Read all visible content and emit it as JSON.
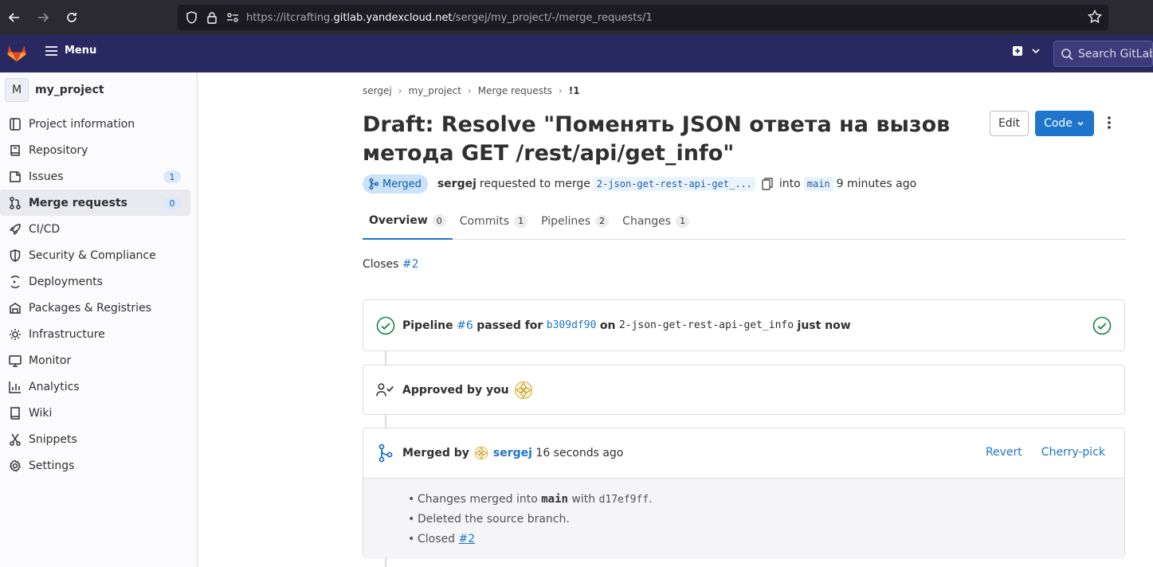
{
  "browser": {
    "url_prefix": "https://itcrafting.",
    "url_host": "gitlab.yandexcloud.net",
    "url_path": "/sergej/my_project/-/merge_requests/1"
  },
  "topbar": {
    "menu_label": "Menu",
    "search_placeholder": "Search GitLab"
  },
  "sidebar": {
    "project_initial": "M",
    "project_name": "my_project",
    "items": [
      {
        "label": "Project information"
      },
      {
        "label": "Repository"
      },
      {
        "label": "Issues",
        "count": "1"
      },
      {
        "label": "Merge requests",
        "count": "0"
      },
      {
        "label": "CI/CD"
      },
      {
        "label": "Security & Compliance"
      },
      {
        "label": "Deployments"
      },
      {
        "label": "Packages & Registries"
      },
      {
        "label": "Infrastructure"
      },
      {
        "label": "Monitor"
      },
      {
        "label": "Analytics"
      },
      {
        "label": "Wiki"
      },
      {
        "label": "Snippets"
      },
      {
        "label": "Settings"
      }
    ]
  },
  "breadcrumb": [
    "sergej",
    "my_project",
    "Merge requests",
    "!1"
  ],
  "mr": {
    "title_line1": "Draft: Resolve \"Поменять JSON ответа на вызов",
    "title_line2": "метода GET /rest/api/get_info\"",
    "edit_label": "Edit",
    "code_label": "Code",
    "status": "Merged",
    "author": "sergej",
    "requested_text": "requested to merge",
    "source_branch": "2-json-get-rest-api-get_...",
    "into_text": "into",
    "target_branch": "main",
    "time": "9 minutes ago"
  },
  "tabs": [
    {
      "label": "Overview",
      "count": "0"
    },
    {
      "label": "Commits",
      "count": "1"
    },
    {
      "label": "Pipelines",
      "count": "2"
    },
    {
      "label": "Changes",
      "count": "1"
    }
  ],
  "description": {
    "closes_text": "Closes",
    "closes_ref": "#2"
  },
  "pipeline": {
    "label": "Pipeline",
    "id": "#6",
    "passed_for": "passed for",
    "commit": "b309df90",
    "on": "on",
    "branch": "2-json-get-rest-api-get_info",
    "when": "just now"
  },
  "approval": {
    "text": "Approved by you"
  },
  "merged": {
    "merged_by": "Merged by",
    "user": "sergej",
    "time": "16 seconds ago",
    "revert_label": "Revert",
    "cherry_pick_label": "Cherry-pick",
    "changes_text_1": "Changes merged into",
    "changes_branch": "main",
    "changes_text_2": "with",
    "changes_commit": "d17ef9ff",
    "changes_text_3": ".",
    "deleted_text": "Deleted the source branch.",
    "closed_text": "Closed",
    "closed_ref": "#2"
  },
  "colors": {
    "topbar": "#292961",
    "primary": "#1f75cb",
    "success": "#108548"
  }
}
